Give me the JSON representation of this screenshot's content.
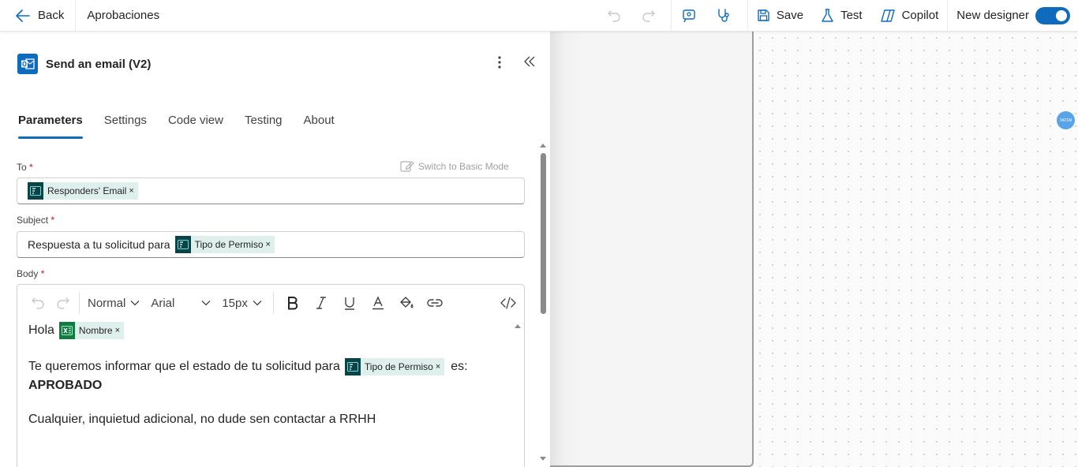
{
  "topbar": {
    "back_label": "Back",
    "flow_name": "Aprobaciones",
    "save_label": "Save",
    "test_label": "Test",
    "copilot_label": "Copilot",
    "new_designer_label": "New designer",
    "new_designer_on": true
  },
  "panel": {
    "title": "Send an email (V2)",
    "tabs": [
      {
        "label": "Parameters",
        "active": true
      },
      {
        "label": "Settings",
        "active": false
      },
      {
        "label": "Code view",
        "active": false
      },
      {
        "label": "Testing",
        "active": false
      },
      {
        "label": "About",
        "active": false
      }
    ],
    "switch_mode_label": "Switch to Basic Mode",
    "to": {
      "label": "To",
      "required_mark": "*",
      "token": "Responders' Email"
    },
    "subject": {
      "label": "Subject",
      "required_mark": "*",
      "text": "Respuesta a tu solicitud para",
      "token": "Tipo de Permiso"
    },
    "body": {
      "label": "Body",
      "required_mark": "*",
      "toolbar": {
        "format": "Normal",
        "font": "Arial",
        "size": "15px"
      },
      "greeting": "Hola",
      "greeting_token": "Nombre",
      "line2_text": "Te queremos informar que el estado de tu solicitud para",
      "line2_token": "Tipo de Permiso",
      "line2_suffix": "es:",
      "status": "APROBADO",
      "closing": "Cualquier, inquietud adicional, no dude sen contactar a RRHH"
    }
  },
  "token_close": "×",
  "canvas": {
    "avatar_text": "3421M"
  },
  "colors": {
    "accent": "#0f6cbd",
    "token_bg": "#dff0ec",
    "token_icon_forms": "#07454a",
    "token_icon_excel": "#107c41"
  }
}
